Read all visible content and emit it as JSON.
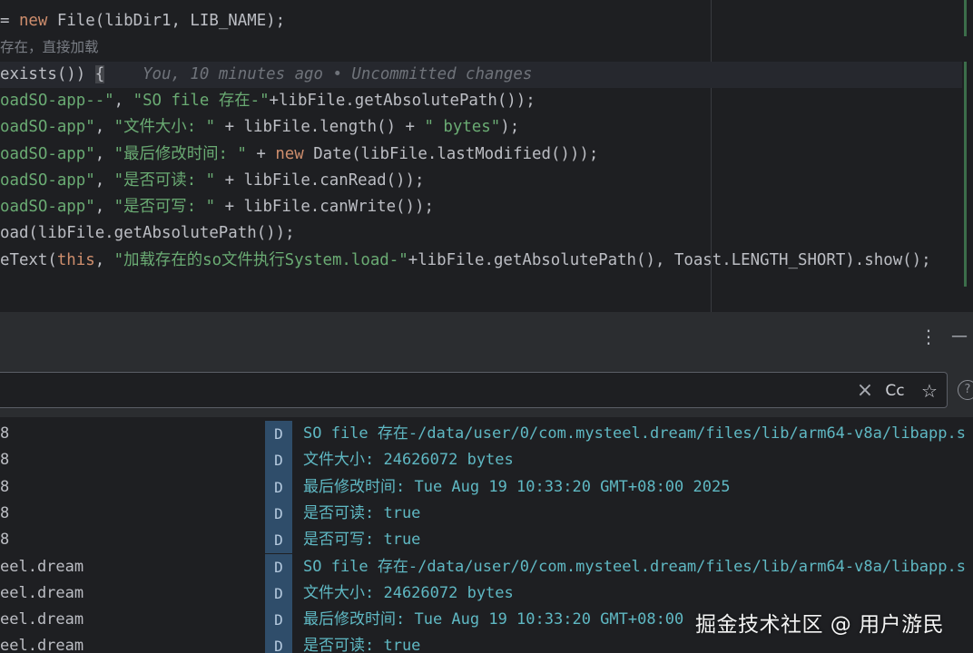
{
  "editor": {
    "lines": [
      {
        "tokens": [
          {
            "c": "t-plain",
            "t": "= "
          },
          {
            "c": "t-kw",
            "t": "new"
          },
          {
            "c": "t-plain",
            "t": " File(libDir1, LIB_NAME);"
          }
        ]
      },
      {
        "tokens": [
          {
            "c": "t-com",
            "t": "存在，直接加载"
          }
        ]
      },
      {
        "current": true,
        "tokens": [
          {
            "c": "t-plain",
            "t": "exists()) "
          },
          {
            "c": "t-brace",
            "t": "{"
          },
          {
            "c": "t-hint",
            "t": "    You, 10 minutes ago • Uncommitted changes"
          }
        ]
      },
      {
        "tokens": [
          {
            "c": "t-str",
            "t": "oadSO-app--\""
          },
          {
            "c": "t-plain",
            "t": ", "
          },
          {
            "c": "t-str",
            "t": "\"SO file 存在-\""
          },
          {
            "c": "t-plain",
            "t": "+libFile.getAbsolutePath());"
          }
        ]
      },
      {
        "tokens": [
          {
            "c": "t-str",
            "t": "oadSO-app\""
          },
          {
            "c": "t-plain",
            "t": ", "
          },
          {
            "c": "t-str",
            "t": "\"文件大小: \""
          },
          {
            "c": "t-plain",
            "t": " + libFile.length() + "
          },
          {
            "c": "t-str",
            "t": "\" bytes\""
          },
          {
            "c": "t-plain",
            "t": ");"
          }
        ]
      },
      {
        "tokens": [
          {
            "c": "t-str",
            "t": "oadSO-app\""
          },
          {
            "c": "t-plain",
            "t": ", "
          },
          {
            "c": "t-str",
            "t": "\"最后修改时间: \""
          },
          {
            "c": "t-plain",
            "t": " + "
          },
          {
            "c": "t-kw",
            "t": "new"
          },
          {
            "c": "t-plain",
            "t": " Date(libFile.lastModified()));"
          }
        ]
      },
      {
        "tokens": [
          {
            "c": "t-str",
            "t": "oadSO-app\""
          },
          {
            "c": "t-plain",
            "t": ", "
          },
          {
            "c": "t-str",
            "t": "\"是否可读: \""
          },
          {
            "c": "t-plain",
            "t": " + libFile.canRead());"
          }
        ]
      },
      {
        "tokens": [
          {
            "c": "t-str",
            "t": "oadSO-app\""
          },
          {
            "c": "t-plain",
            "t": ", "
          },
          {
            "c": "t-str",
            "t": "\"是否可写: \""
          },
          {
            "c": "t-plain",
            "t": " + libFile.canWrite());"
          }
        ]
      },
      {
        "tokens": [
          {
            "c": "t-plain",
            "t": "oad(libFile.getAbsolutePath());"
          }
        ]
      },
      {
        "tokens": [
          {
            "c": "t-plain",
            "t": "eText("
          },
          {
            "c": "t-kw",
            "t": "this"
          },
          {
            "c": "t-plain",
            "t": ", "
          },
          {
            "c": "t-str",
            "t": "\"加载存在的so文件执行System.load-\""
          },
          {
            "c": "t-plain",
            "t": "+libFile.getAbsolutePath(), Toast.LENGTH_SHORT).show();"
          }
        ]
      }
    ]
  },
  "panel": {
    "more_icon": "⋮",
    "minimize_icon": "—",
    "filter": {
      "value": "",
      "clear_icon": "×",
      "match_case_label": "Cc",
      "favorite_icon": "☆"
    },
    "help_icon": "?"
  },
  "log": {
    "rows": [
      {
        "tag": "8",
        "level": "D",
        "message": "SO file 存在-/data/user/0/com.mysteel.dream/files/lib/arm64-v8a/libapp.s"
      },
      {
        "tag": "8",
        "level": "D",
        "message": "文件大小: 24626072 bytes"
      },
      {
        "tag": "8",
        "level": "D",
        "message": "最后修改时间: Tue Aug 19 10:33:20 GMT+08:00 2025"
      },
      {
        "tag": "8",
        "level": "D",
        "message": "是否可读: true"
      },
      {
        "tag": "8",
        "level": "D",
        "message": "是否可写: true"
      },
      {
        "tag": "eel.dream",
        "level": "D",
        "message": "SO file 存在-/data/user/0/com.mysteel.dream/files/lib/arm64-v8a/libapp.s"
      },
      {
        "tag": "eel.dream",
        "level": "D",
        "message": "文件大小: 24626072 bytes"
      },
      {
        "tag": "eel.dream",
        "level": "D",
        "message": "最后修改时间: Tue Aug 19 10:33:20 GMT+08:00"
      },
      {
        "tag": "eel.dream",
        "level": "D",
        "message": "是否可读: true"
      }
    ]
  },
  "watermark": "掘金技术社区 @ 用户游民",
  "colors": {
    "background": "#1e1f22",
    "panel": "#2b2d30",
    "keyword": "#cf8e6d",
    "string": "#6aab73",
    "log_message": "#5fb8c3",
    "debug_badge": "#2f4d6a"
  }
}
